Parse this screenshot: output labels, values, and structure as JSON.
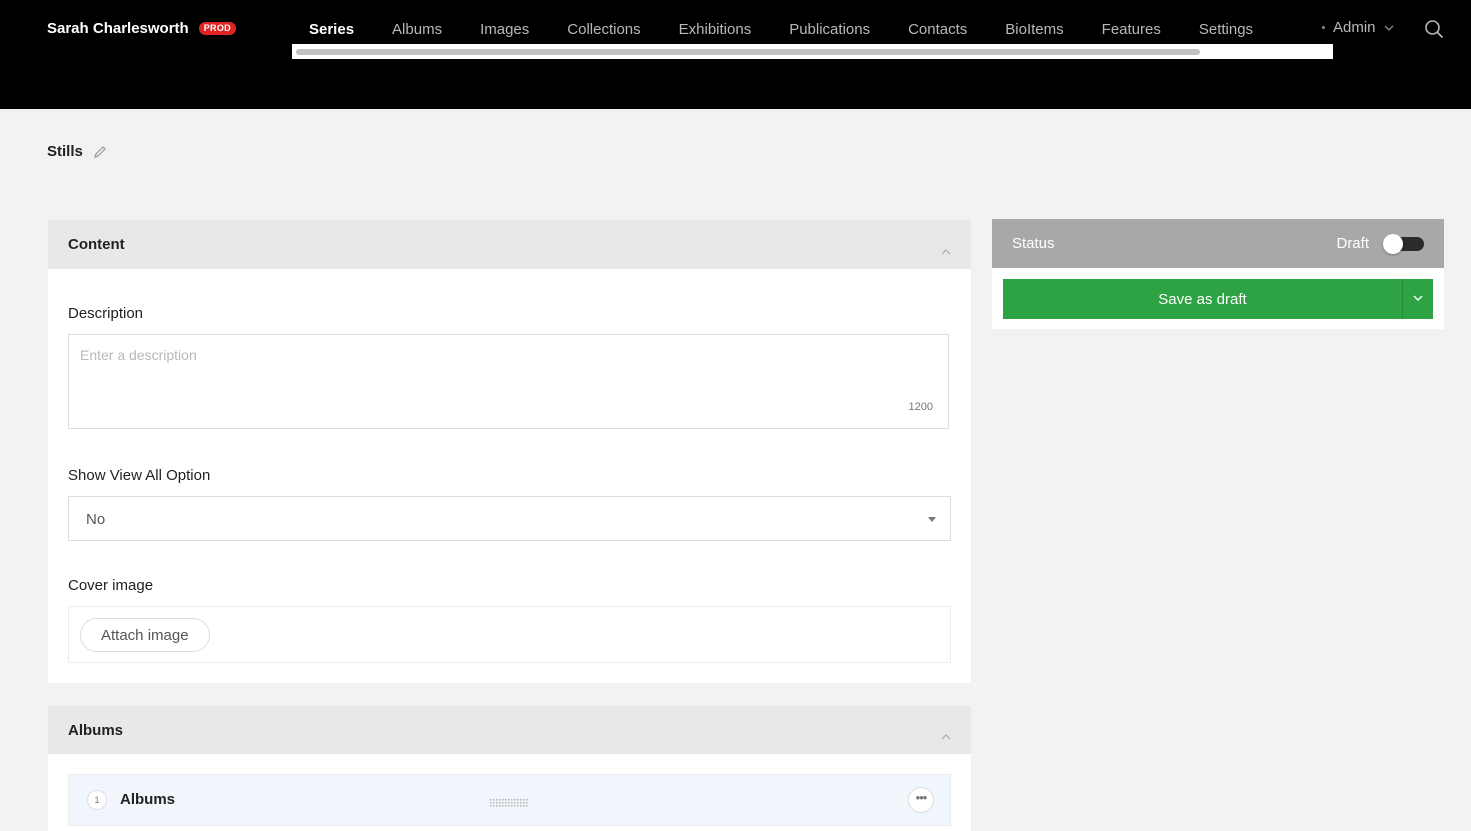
{
  "header": {
    "brand": "Sarah Charlesworth",
    "env_badge": "PROD",
    "nav": [
      "Series",
      "Albums",
      "Images",
      "Collections",
      "Exhibitions",
      "Publications",
      "Contacts",
      "BioItems",
      "Features",
      "Settings"
    ],
    "active_nav": "Series",
    "admin_label": "Admin",
    "colors": {
      "background": "#000000",
      "badge": "#e02424"
    }
  },
  "page": {
    "title": "Stills"
  },
  "content": {
    "section_title": "Content",
    "description": {
      "label": "Description",
      "placeholder": "Enter a description",
      "char_count": "1200"
    },
    "view_all": {
      "label": "Show View All Option",
      "selected": "No"
    },
    "cover_image": {
      "label": "Cover image",
      "button": "Attach image"
    }
  },
  "albums": {
    "section_title": "Albums",
    "rows": [
      {
        "index": "1",
        "title": "Albums"
      }
    ]
  },
  "status": {
    "title": "Status",
    "state_label": "Draft",
    "save_label": "Save as draft",
    "colors": {
      "save": "#2ea343"
    }
  }
}
